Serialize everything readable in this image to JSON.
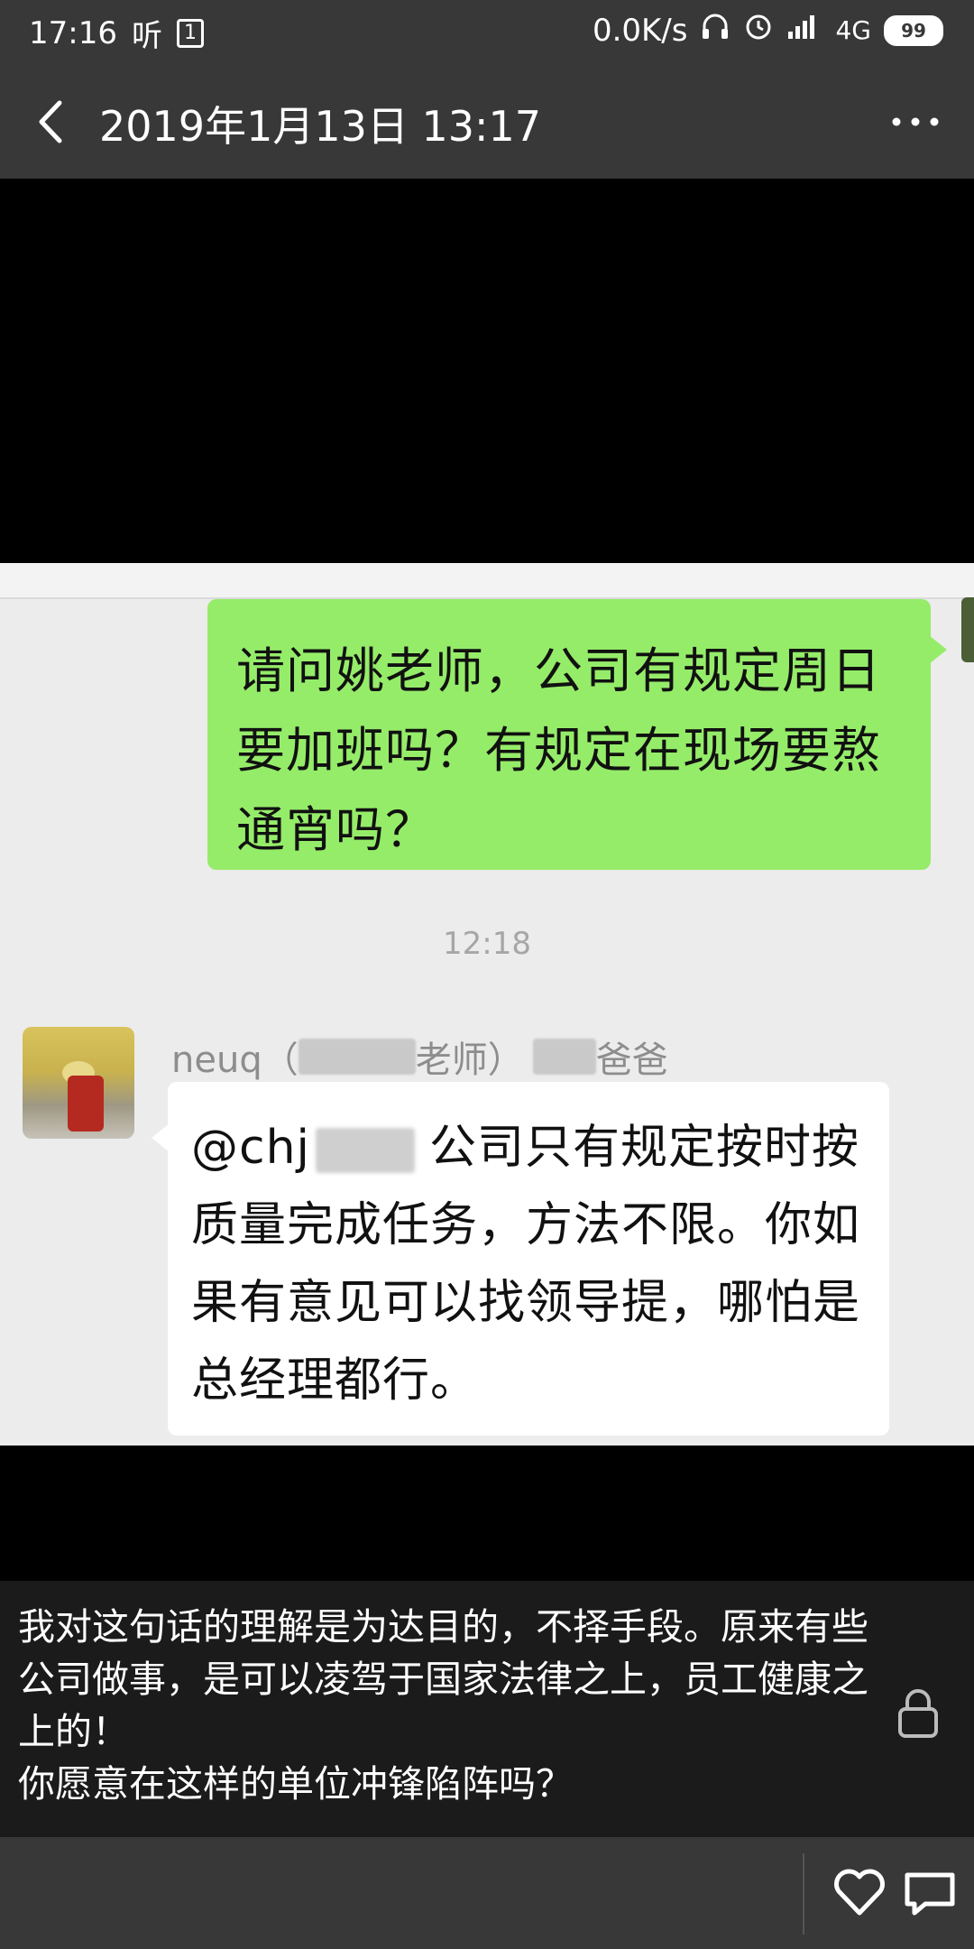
{
  "status_bar": {
    "time": "17:16",
    "listen_icon_text": "听",
    "sim_slot": "1",
    "net_speed": "0.0K/s",
    "network": "4G",
    "battery": "99"
  },
  "app_bar": {
    "title": "2019年1月13日 13:17"
  },
  "chat": {
    "outgoing_message": "请问姚老师，公司有规定周日要加班吗？有规定在现场要熬通宵吗？",
    "timestamp": "12:18",
    "sender_prefix": "neuq（",
    "sender_role": "老师）",
    "sender_suffix": "爸爸",
    "incoming_mention": "@chj",
    "incoming_message_1": "公司只有规定按时",
    "incoming_message_2": "按质量完成任务，方法不限。你如果有意见可以找领导提，哪怕是总经理都行。"
  },
  "caption": {
    "line_1": "我对这句话的理解是为达目的，不择手段。原来有些公司做事，是可以凌驾于国家法律之上，员工健康之上的！",
    "line_2": "你愿意在这样的单位冲锋陷阵吗？"
  },
  "colors": {
    "bar_bg": "#383838",
    "bubble_green": "#95ec69",
    "chat_bg": "#ececec"
  },
  "icons": {
    "back": "chevron-left-icon",
    "more": "more-dots-icon",
    "lock": "lock-icon",
    "like": "heart-icon",
    "comment": "comment-icon"
  }
}
